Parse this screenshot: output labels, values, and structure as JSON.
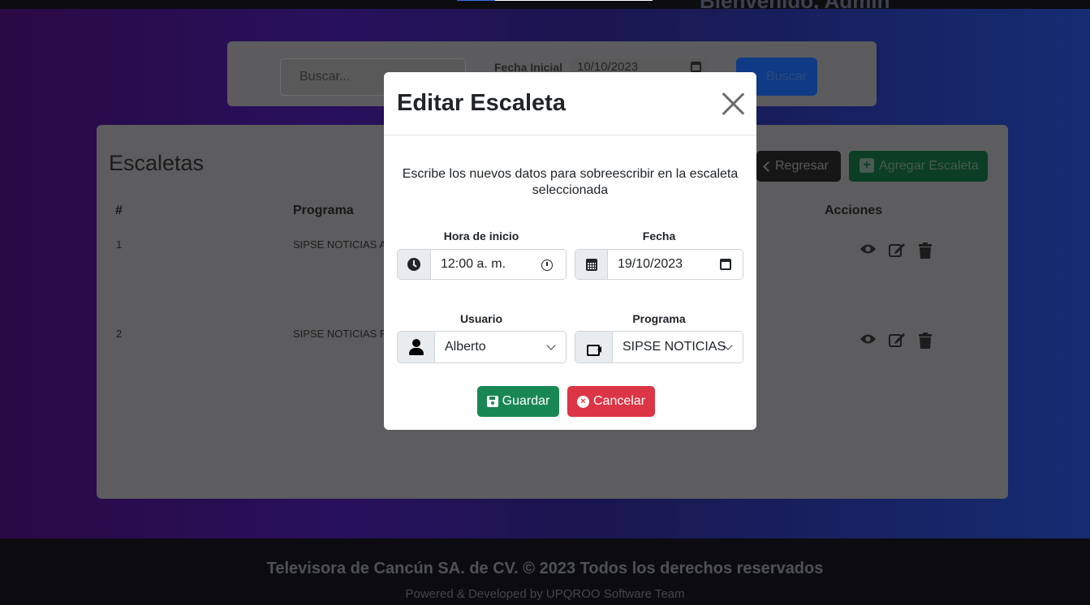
{
  "header": {
    "welcome": "Bienvenido, Admin"
  },
  "search": {
    "placeholder": "Buscar...",
    "fecha_inicial_label": "Fecha Inicial",
    "fecha_inicial_value": "10/10/2023",
    "button_label": "Buscar"
  },
  "card": {
    "title": "Escaletas",
    "back_label": "Regresar",
    "add_label": "Agregar Escaleta",
    "columns": [
      "#",
      "Programa",
      "Acciones"
    ],
    "rows": [
      {
        "num": "1",
        "programa": "SIPSE NOTICIAS A"
      },
      {
        "num": "2",
        "programa": "SIPSE NOTICIAS F"
      }
    ]
  },
  "modal": {
    "title": "Editar Escaleta",
    "description": "Escribe los nuevos datos para sobreescribir en la escaleta seleccionada",
    "hora_label": "Hora de inicio",
    "hora_value": "12:00 a. m.",
    "fecha_label": "Fecha",
    "fecha_value": "19/10/2023",
    "usuario_label": "Usuario",
    "usuario_value": "Alberto",
    "programa_label": "Programa",
    "programa_value": "SIPSE NOTICIAS",
    "save_label": "Guardar",
    "cancel_label": "Cancelar"
  },
  "footer": {
    "line1": "Televisora de Cancún SA. de CV. © 2023 Todos los derechos reservados",
    "line2": "Powered & Developed by UPQROO Software Team"
  },
  "colors": {
    "save": "#198754",
    "cancel": "#dc3545",
    "primary": "#0d6efd"
  }
}
